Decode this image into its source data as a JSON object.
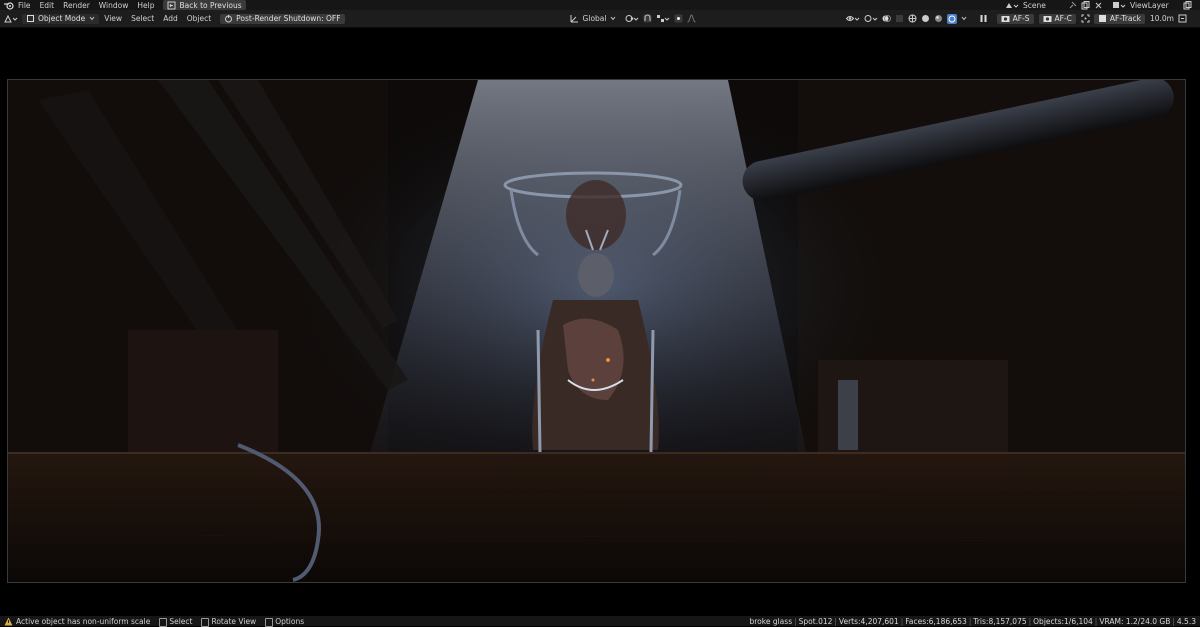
{
  "menu": {
    "items": [
      "File",
      "Edit",
      "Render",
      "Window",
      "Help"
    ],
    "back_button": "Back to Previous",
    "scene_name": "Scene",
    "view_layer": "ViewLayer"
  },
  "header": {
    "mode": "Object Mode",
    "menus": [
      "View",
      "Select",
      "Add",
      "Object"
    ],
    "post_render": "Post-Render Shutdown: OFF",
    "orientation": "Global",
    "af_s": "AF-S",
    "af_c": "AF-C",
    "af_track": "AF-Track",
    "distance": "10.0m"
  },
  "status": {
    "warning": "Active object has non-uniform scale",
    "hint_select": "Select",
    "hint_rotate": "Rotate View",
    "hint_options": "Options",
    "object_name": "broke glass",
    "light": "Spot.012",
    "verts": "Verts:4,207,601",
    "faces": "Faces:6,186,653",
    "tris": "Tris:8,157,075",
    "objects": "Objects:1/6,104",
    "vram": "VRAM: 1.2/24.0 GB",
    "version": "4.5.3"
  },
  "colors": {
    "accent": "#4a80c8",
    "header_bg": "#1d1d1d",
    "status_bg": "#161616"
  }
}
